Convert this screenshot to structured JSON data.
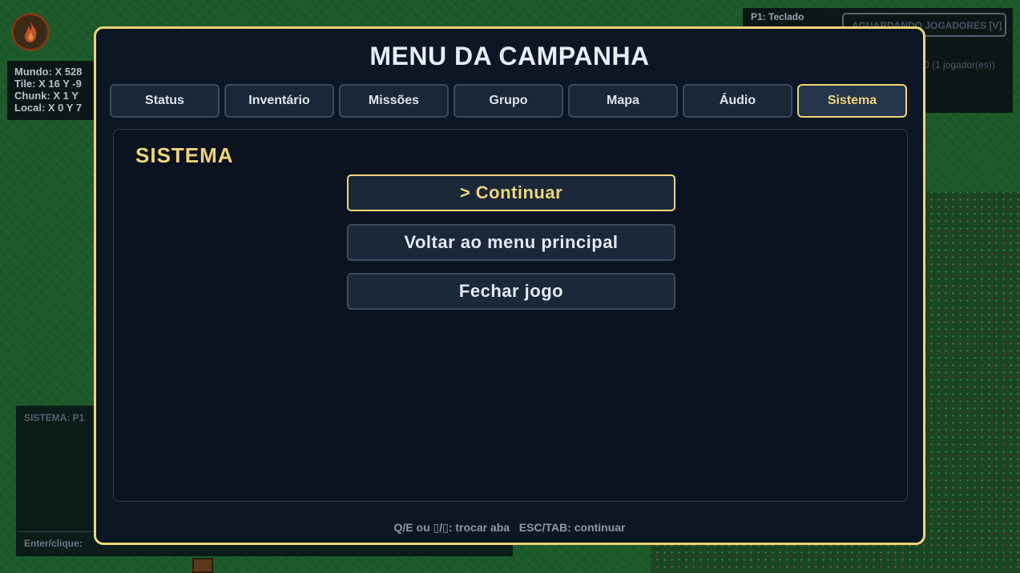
{
  "background": {
    "coords": {
      "mundo": "Mundo: X 528",
      "tile": "Tile: X 16  Y -9",
      "chunk": "Chunk: X 1  Y",
      "local": "Local: X 0  Y 7"
    },
    "player_panel": {
      "p1": "P1: Teclado",
      "awaiting": "AGUARDANDO JOGADORES  [V]",
      "players_count": "0 (1 jogador(es))"
    },
    "system_log": {
      "title": "SISTEMA: P1",
      "enter_hint": "Enter/clique:"
    }
  },
  "menu": {
    "title": "MENU DA CAMPANHA",
    "tabs": [
      {
        "label": "Status"
      },
      {
        "label": "Inventário"
      },
      {
        "label": "Missões"
      },
      {
        "label": "Grupo"
      },
      {
        "label": "Mapa"
      },
      {
        "label": "Áudio"
      },
      {
        "label": "Sistema",
        "active": true
      }
    ],
    "panel_title": "SISTEMA",
    "options": [
      {
        "label": "> Continuar",
        "selected": true
      },
      {
        "label": "Voltar ao menu principal"
      },
      {
        "label": "Fechar jogo"
      }
    ],
    "footer_hint": "Q/E ou ▯/▯: trocar aba   ESC/TAB: continuar"
  },
  "colors": {
    "accent": "#f0d478",
    "overlay_bg": "#0c1624",
    "grass": "#1c5a2a"
  }
}
